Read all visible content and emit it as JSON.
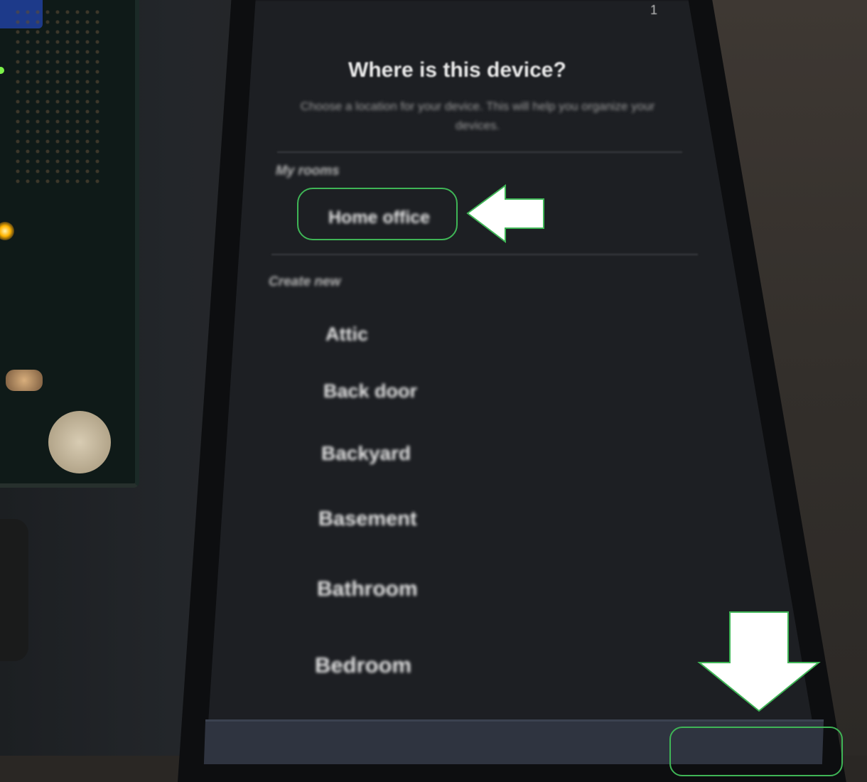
{
  "status_bar": {
    "indicator": "1"
  },
  "screen": {
    "title": "Where is this device?",
    "subtitle": "Choose a location for your device. This will help you organize your devices."
  },
  "my_rooms": {
    "label": "My rooms",
    "items": [
      {
        "label": "Home office",
        "highlighted": true
      }
    ]
  },
  "create_new": {
    "label": "Create new",
    "items": [
      {
        "label": "Attic"
      },
      {
        "label": "Back door"
      },
      {
        "label": "Backyard"
      },
      {
        "label": "Basement"
      },
      {
        "label": "Bathroom"
      },
      {
        "label": "Bedroom"
      }
    ]
  },
  "annotations": {
    "highlight_color": "#3fb556",
    "arrow_color": "#ffffff",
    "arrow_left_icon": "arrow-left-icon",
    "arrow_down_icon": "arrow-down-icon"
  },
  "colors": {
    "screen_background": "#1d1f23",
    "title_text": "#ececec",
    "bottom_bar": "#2f3440"
  }
}
